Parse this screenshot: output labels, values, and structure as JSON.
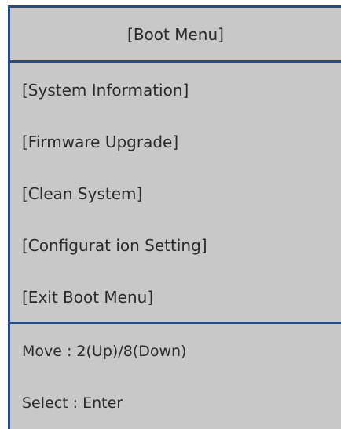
{
  "header": {
    "title": "[Boot Menu]"
  },
  "menu": {
    "items": [
      {
        "label": "[System Information]"
      },
      {
        "label": "[Firmware Upgrade]"
      },
      {
        "label": "[Clean System]"
      },
      {
        "label": "[Configurat ion Setting]"
      },
      {
        "label": "[Exit Boot Menu]"
      }
    ]
  },
  "help": {
    "move": "Move : 2(Up)/8(Down)",
    "select": "Select : Enter"
  },
  "colors": {
    "panel_background": "#c8c8c8",
    "border": "#2c4a7c",
    "text": "#2b2b2b"
  }
}
